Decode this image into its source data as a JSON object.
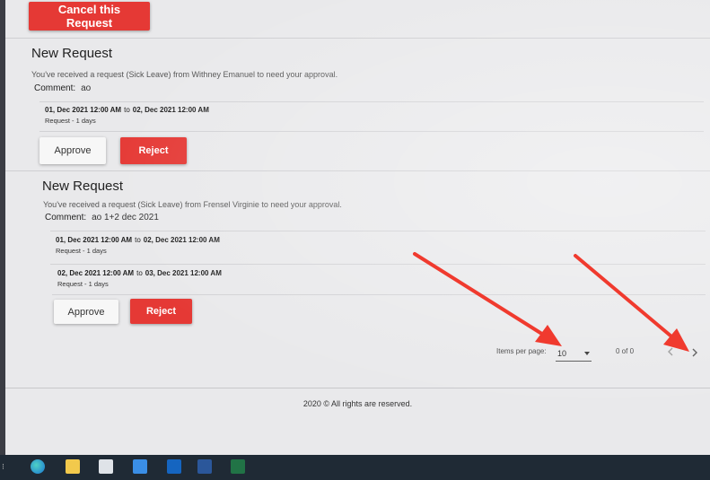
{
  "header": {
    "cancel_label": "Cancel this Request"
  },
  "requests": [
    {
      "title": "New Request",
      "description": "You've received a request (Sick Leave) from Withney Emanuel to need your approval.",
      "comment_label": "Comment:",
      "comment": "ao",
      "dates": [
        {
          "from": "01, Dec 2021 12:00 AM",
          "to_word": "to",
          "to": "02, Dec 2021 12:00 AM",
          "days": "Request - 1 days"
        }
      ],
      "approve_label": "Approve",
      "reject_label": "Reject"
    },
    {
      "title": "New Request",
      "description": "You've received a request (Sick Leave) from Frensel Virginie to need your approval.",
      "comment_label": "Comment:",
      "comment": "ao 1+2 dec 2021",
      "dates": [
        {
          "from": "01, Dec 2021 12:00 AM",
          "to_word": "to",
          "to": "02, Dec 2021 12:00 AM",
          "days": "Request - 1 days"
        },
        {
          "from": "02, Dec 2021 12:00 AM",
          "to_word": "to",
          "to": "03, Dec 2021 12:00 AM",
          "days": "Request - 1 days"
        }
      ],
      "approve_label": "Approve",
      "reject_label": "Reject"
    }
  ],
  "pagination": {
    "items_per_page_label": "Items per page:",
    "items_per_page": "10",
    "range": "0 of 0",
    "prev_icon": "chevron-left-icon",
    "next_icon": "chevron-right-icon"
  },
  "footer": {
    "text": "2020 © All rights are reserved."
  },
  "colors": {
    "accent": "#e53935",
    "background": "#e9e9eb",
    "annotation": "#f03a2e",
    "taskbar": "#1f2a35"
  },
  "taskbar": {
    "icons": [
      "edge-icon",
      "file-explorer-icon",
      "calendar-icon",
      "mail-icon",
      "outlook-icon",
      "word-icon",
      "excel-icon"
    ]
  }
}
